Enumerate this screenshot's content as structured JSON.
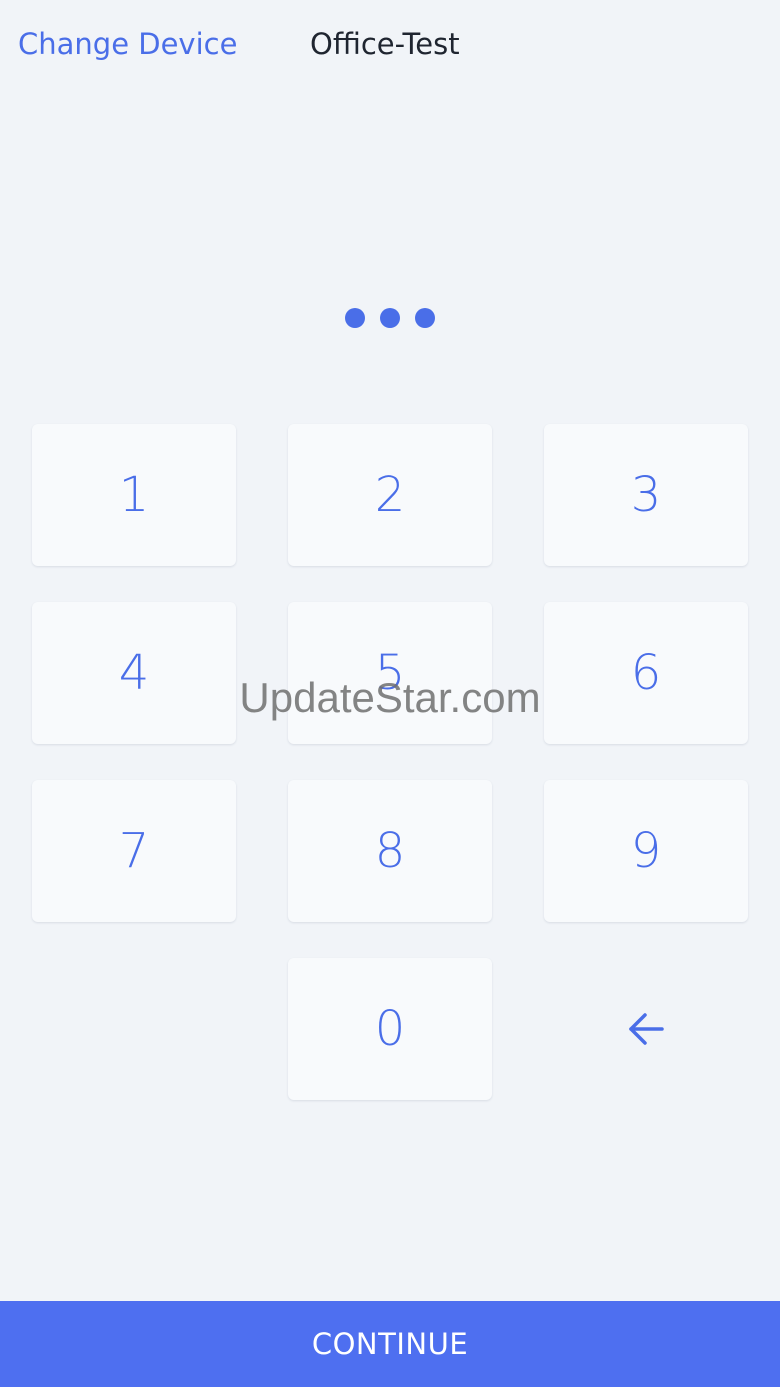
{
  "header": {
    "change_device_label": "Change Device",
    "device_name": "Office-Test"
  },
  "pin": {
    "entered_count": 3
  },
  "keypad": {
    "keys": [
      "1",
      "2",
      "3",
      "4",
      "5",
      "6",
      "7",
      "8",
      "9",
      "0"
    ],
    "backspace_icon": "arrow-left-icon"
  },
  "watermark": "UpdateStar.com",
  "footer": {
    "continue_label": "CONTINUE"
  },
  "colors": {
    "accent": "#4a6ee8",
    "background": "#f1f4f8",
    "key_background": "#f8fafc",
    "continue_bar": "#4e6ff0"
  }
}
